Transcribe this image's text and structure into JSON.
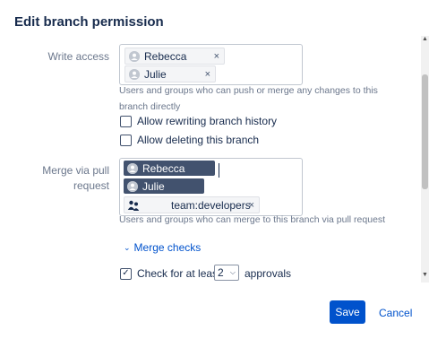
{
  "dialog": {
    "title": "Edit branch permission"
  },
  "write_access": {
    "label": "Write access",
    "users": [
      {
        "name": "Rebecca",
        "remove": "×"
      },
      {
        "name": "Julie",
        "remove": "×"
      }
    ],
    "help": "Users and groups who can push or merge any changes to this branch directly"
  },
  "options": {
    "allow_rewriting": {
      "label": "Allow rewriting branch history",
      "checked": false
    },
    "allow_deleting": {
      "label": "Allow deleting this branch",
      "checked": false
    }
  },
  "merge_via_pr": {
    "label_line1": "Merge via pull",
    "label_line2": "request",
    "users": [
      {
        "name": "Rebecca"
      },
      {
        "name": "Julie"
      }
    ],
    "group": {
      "name": "team:developers",
      "remove": "×"
    },
    "help": "Users and groups who can merge to this branch via pull request"
  },
  "merge_checks": {
    "toggle_label": "Merge checks",
    "chevron": "chevron-down-icon",
    "approvals_check": {
      "label": "Check for at least",
      "checked": true
    },
    "approvals_count": "2",
    "approvals_suffix": "approvals"
  },
  "footer": {
    "save": "Save",
    "cancel": "Cancel"
  },
  "colors": {
    "primary": "#0052cc",
    "chip_selected": "#42526e",
    "text": "#172b4d",
    "muted": "#6b778c"
  }
}
